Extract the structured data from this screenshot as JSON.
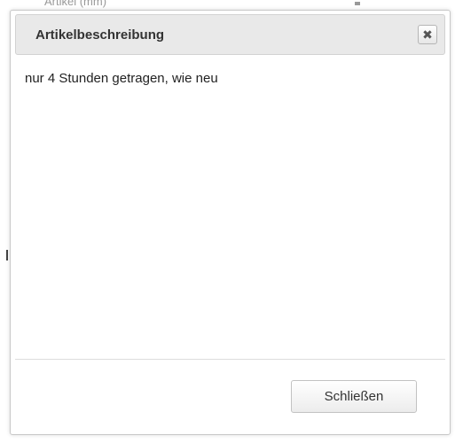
{
  "background": {
    "partial_text": "Artikel (mm)"
  },
  "dialog": {
    "title": "Artikelbeschreibung",
    "close_icon": "✖",
    "body_text": "nur 4 Stunden getragen, wie neu",
    "close_button_label": "Schließen"
  },
  "colors": {
    "titlebar_bg": "#e9e9e9",
    "border": "#c8c8c8",
    "text": "#222222"
  }
}
